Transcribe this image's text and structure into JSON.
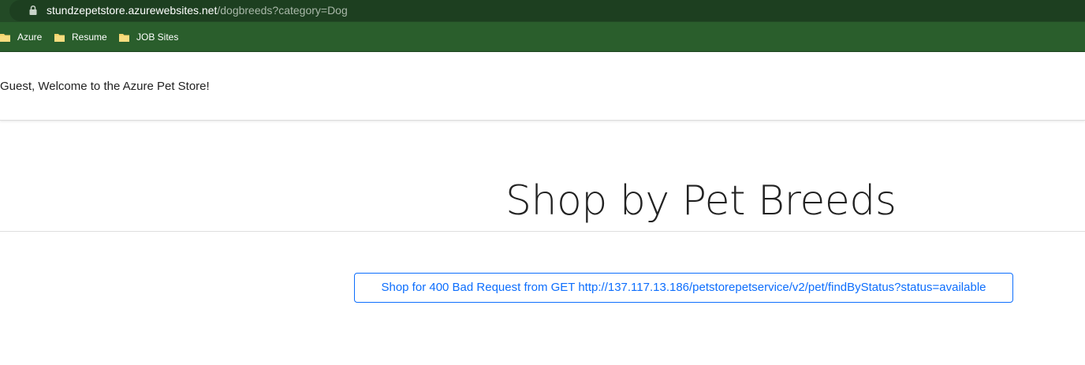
{
  "browser": {
    "url_domain": "stundzepetstore.azurewebsites.net",
    "url_path": "/dogbreeds?category=Dog",
    "bookmarks": [
      {
        "label": "Azure",
        "icon": "folder-icon"
      },
      {
        "label": "Resume",
        "icon": "folder-icon"
      },
      {
        "label": "JOB Sites",
        "icon": "folder-icon"
      }
    ]
  },
  "header": {
    "welcome": "Guest, Welcome to the Azure Pet Store!"
  },
  "main": {
    "title": "Shop by Pet Breeds",
    "shop_button_label": "Shop for 400 Bad Request from GET http://137.117.13.186/petstorepetservice/v2/pet/findByStatus?status=available"
  },
  "colors": {
    "address_bar": "#234a26",
    "bookmarks_bar": "#2a5e2c",
    "accent": "#0d6efd",
    "folder": "#f3d36b"
  }
}
